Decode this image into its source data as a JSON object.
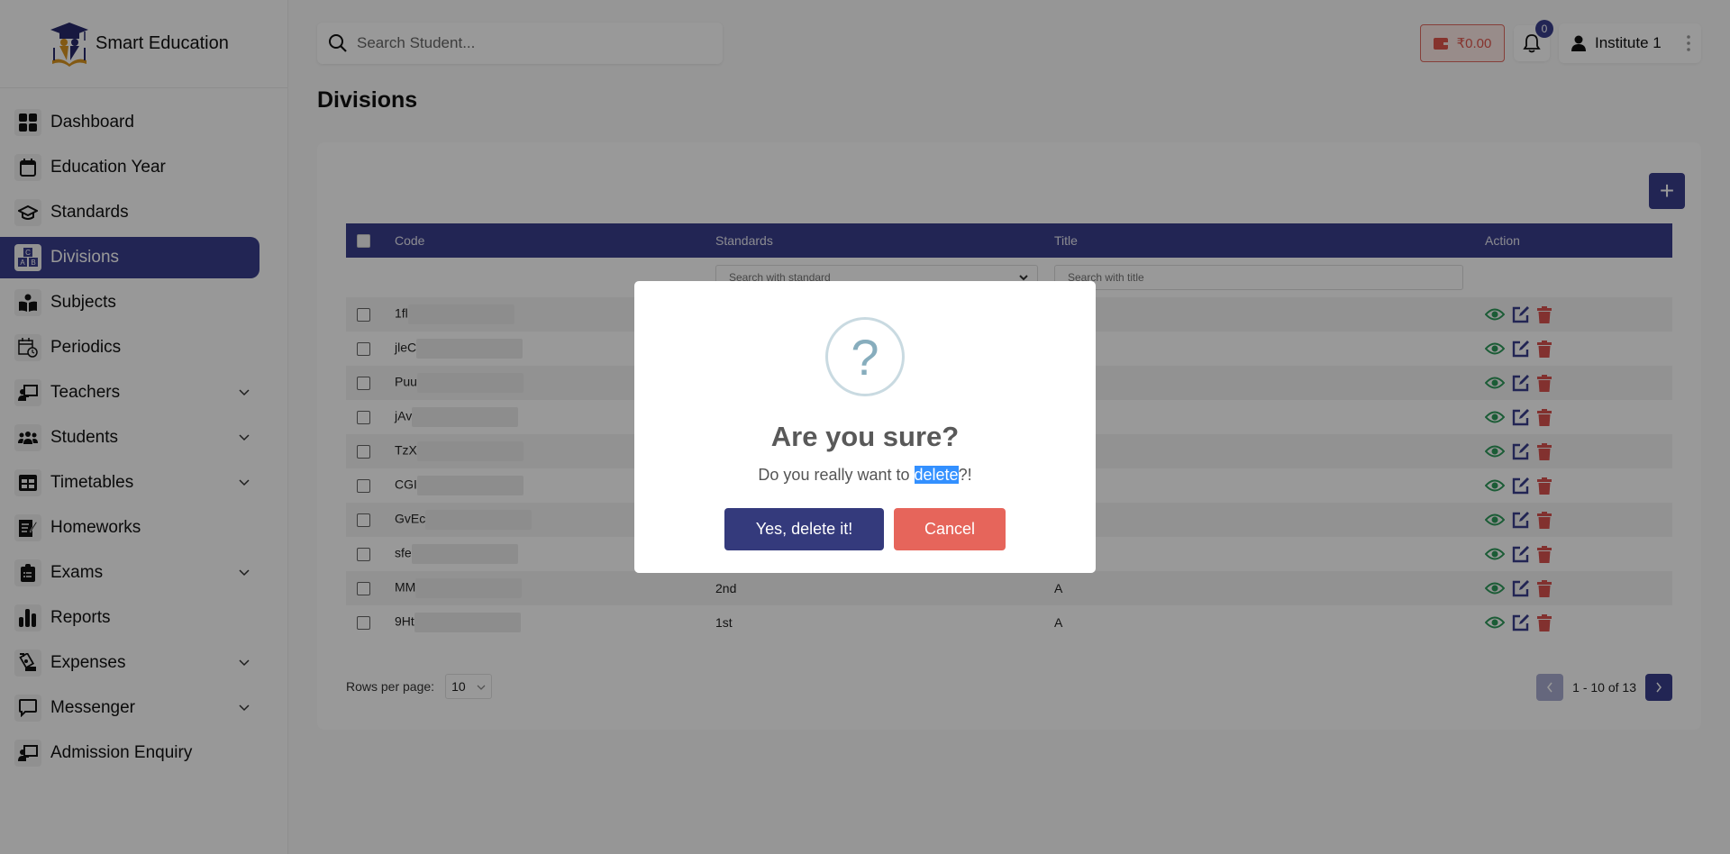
{
  "brand": {
    "name": "Smart Education"
  },
  "sidebar": {
    "items": [
      {
        "label": "Dashboard",
        "icon": "dashboard-icon",
        "expandable": false,
        "active": false
      },
      {
        "label": "Education Year",
        "icon": "calendar-icon",
        "expandable": false,
        "active": false
      },
      {
        "label": "Standards",
        "icon": "graduation-cap-icon",
        "expandable": false,
        "active": false
      },
      {
        "label": "Divisions",
        "icon": "abc-blocks-icon",
        "expandable": false,
        "active": true
      },
      {
        "label": "Subjects",
        "icon": "book-reader-icon",
        "expandable": false,
        "active": false
      },
      {
        "label": "Periodics",
        "icon": "calendar-clock-icon",
        "expandable": false,
        "active": false
      },
      {
        "label": "Teachers",
        "icon": "teacher-board-icon",
        "expandable": true,
        "active": false
      },
      {
        "label": "Students",
        "icon": "users-icon",
        "expandable": true,
        "active": false
      },
      {
        "label": "Timetables",
        "icon": "table-icon",
        "expandable": true,
        "active": false
      },
      {
        "label": "Homeworks",
        "icon": "homework-icon",
        "expandable": false,
        "active": false
      },
      {
        "label": "Exams",
        "icon": "clipboard-icon",
        "expandable": true,
        "active": false
      },
      {
        "label": "Reports",
        "icon": "bar-chart-icon",
        "expandable": false,
        "active": false
      },
      {
        "label": "Expenses",
        "icon": "money-hand-icon",
        "expandable": true,
        "active": false
      },
      {
        "label": "Messenger",
        "icon": "chat-icon",
        "expandable": true,
        "active": false
      },
      {
        "label": "Admission Enquiry",
        "icon": "teacher-board-icon",
        "expandable": false,
        "active": false
      }
    ]
  },
  "header": {
    "search_placeholder": "Search Student...",
    "wallet_amount": "₹0.00",
    "notifications_count": "0",
    "user_name": "Institute 1"
  },
  "page": {
    "title": "Divisions"
  },
  "table": {
    "add_label": "+",
    "columns": [
      "Code",
      "Standards",
      "Title",
      "Action"
    ],
    "filters": {
      "standard_placeholder": "Search with standard",
      "title_placeholder": "Search with title"
    },
    "rows": [
      {
        "code": "1fl",
        "standard": "",
        "title": ""
      },
      {
        "code": "jleC",
        "standard": "",
        "title": ""
      },
      {
        "code": "Puu",
        "standard": "",
        "title": ""
      },
      {
        "code": "jAv",
        "standard": "",
        "title": ""
      },
      {
        "code": "TzX",
        "standard": "",
        "title": ""
      },
      {
        "code": "CGI",
        "standard": "",
        "title": ""
      },
      {
        "code": "GvEc",
        "standard": "",
        "title": ""
      },
      {
        "code": "sfe",
        "standard": "",
        "title": ""
      },
      {
        "code": "MM",
        "standard": "2nd",
        "title": "A"
      },
      {
        "code": "9Ht",
        "standard": "1st",
        "title": "A"
      }
    ],
    "rows_per_page_label": "Rows per page:",
    "rows_per_page": "10",
    "pagination_text": "1 - 10 of 13"
  },
  "dialog": {
    "icon": "question-icon",
    "title": "Are you sure?",
    "text_before": "Do you really want to ",
    "text_selected": "delete",
    "text_after": "?!",
    "confirm_label": "Yes, delete it!",
    "cancel_label": "Cancel"
  },
  "colors": {
    "primary": "#3a3e8c",
    "danger": "#e6655b",
    "view_icon": "#2e9a5a",
    "delete_icon": "#d9534f"
  }
}
